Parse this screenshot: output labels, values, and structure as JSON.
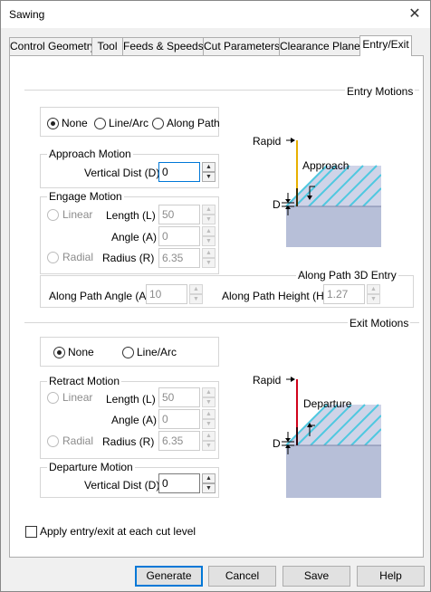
{
  "window": {
    "title": "Sawing",
    "close_glyph": "✕"
  },
  "tabs": [
    {
      "label": "Control Geometry"
    },
    {
      "label": "Tool"
    },
    {
      "label": "Feeds & Speeds"
    },
    {
      "label": "Cut Parameters"
    },
    {
      "label": "Clearance Plane"
    },
    {
      "label": "Entry/Exit",
      "active": true
    }
  ],
  "entry": {
    "section_label": "Entry Motions",
    "mode_options": [
      "None",
      "Line/Arc",
      "Along Path"
    ],
    "selected_mode": "None",
    "approach": {
      "group_label": "Approach Motion",
      "vertical_dist_label": "Vertical Dist (D):",
      "vertical_dist_value": "0"
    },
    "engage": {
      "group_label": "Engage Motion",
      "linear_label": "Linear",
      "radial_label": "Radial",
      "length_label": "Length (L)",
      "length_value": "50",
      "angle_label": "Angle (A)",
      "angle_value": "0",
      "radius_label": "Radius (R)",
      "radius_value": "6.35"
    },
    "along_path": {
      "group_label": "Along Path 3D Entry",
      "angle_label": "Along Path Angle (A)",
      "angle_value": "10",
      "height_label": "Along Path Height (H)",
      "height_value": "1.27"
    },
    "diagram": {
      "rapid_label": "Rapid",
      "approach_label": "Approach",
      "d_label": "D",
      "rapid_color": "#e8b000"
    }
  },
  "exit": {
    "section_label": "Exit Motions",
    "mode_options": [
      "None",
      "Line/Arc"
    ],
    "selected_mode": "None",
    "retract": {
      "group_label": "Retract Motion",
      "linear_label": "Linear",
      "radial_label": "Radial",
      "length_label": "Length (L)",
      "length_value": "50",
      "angle_label": "Angle (A)",
      "angle_value": "0",
      "radius_label": "Radius (R)",
      "radius_value": "6.35"
    },
    "departure": {
      "group_label": "Departure Motion",
      "vertical_dist_label": "Vertical Dist (D):",
      "vertical_dist_value": "0"
    },
    "diagram": {
      "rapid_label": "Rapid",
      "departure_label": "Departure",
      "d_label": "D",
      "rapid_color": "#d0021b"
    }
  },
  "apply_each_level": {
    "label": "Apply entry/exit at each cut level",
    "checked": false
  },
  "buttons": {
    "generate": "Generate",
    "cancel": "Cancel",
    "save": "Save",
    "help": "Help"
  },
  "colors": {
    "accent": "#0078d7",
    "stock_top": "#4fc8e0",
    "stock_side": "#b7bfd8",
    "panel_border": "#adadad"
  }
}
